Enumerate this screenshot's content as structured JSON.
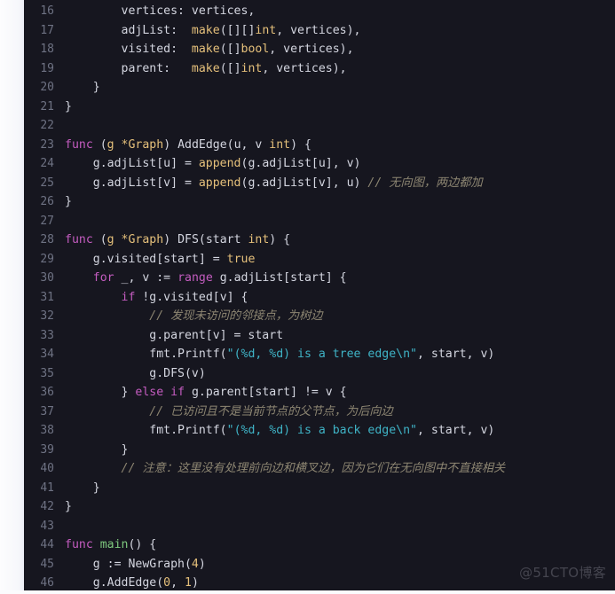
{
  "editor": {
    "language": "go",
    "theme": "dark",
    "first_line_number": 16,
    "colors": {
      "background": "#16161f",
      "gutter_text": "#6e7283",
      "default_text": "#d4d6e0",
      "keyword": "#c45cc0",
      "type_builtin": "#e5c07b",
      "function": "#7ec87e",
      "string": "#3fb3c6",
      "number": "#e5c07b",
      "comment": "#8d8672",
      "page_margin": "#fbfbfd"
    },
    "lines": [
      {
        "n": "16",
        "tokens": [
          {
            "t": "        vertices: vertices,",
            "c": "pln"
          }
        ]
      },
      {
        "n": "17",
        "tokens": [
          {
            "t": "        adjList:  ",
            "c": "pln"
          },
          {
            "t": "make",
            "c": "typ"
          },
          {
            "t": "([][]",
            "c": "pln"
          },
          {
            "t": "int",
            "c": "typ"
          },
          {
            "t": ", vertices),",
            "c": "pln"
          }
        ]
      },
      {
        "n": "18",
        "tokens": [
          {
            "t": "        visited:  ",
            "c": "pln"
          },
          {
            "t": "make",
            "c": "typ"
          },
          {
            "t": "([]",
            "c": "pln"
          },
          {
            "t": "bool",
            "c": "typ"
          },
          {
            "t": ", vertices),",
            "c": "pln"
          }
        ]
      },
      {
        "n": "19",
        "tokens": [
          {
            "t": "        parent:   ",
            "c": "pln"
          },
          {
            "t": "make",
            "c": "typ"
          },
          {
            "t": "([]",
            "c": "pln"
          },
          {
            "t": "int",
            "c": "typ"
          },
          {
            "t": ", vertices),",
            "c": "pln"
          }
        ]
      },
      {
        "n": "20",
        "tokens": [
          {
            "t": "    }",
            "c": "pln"
          }
        ]
      },
      {
        "n": "21",
        "tokens": [
          {
            "t": "}",
            "c": "pln"
          }
        ]
      },
      {
        "n": "22",
        "tokens": [
          {
            "t": "",
            "c": "pln"
          }
        ]
      },
      {
        "n": "23",
        "tokens": [
          {
            "t": "func",
            "c": "kw"
          },
          {
            "t": " (",
            "c": "pln"
          },
          {
            "t": "g *Graph",
            "c": "typ"
          },
          {
            "t": ") AddEdge(u, v ",
            "c": "pln"
          },
          {
            "t": "int",
            "c": "typ"
          },
          {
            "t": ") {",
            "c": "pln"
          }
        ]
      },
      {
        "n": "24",
        "tokens": [
          {
            "t": "    g.adjList[u] = ",
            "c": "pln"
          },
          {
            "t": "append",
            "c": "typ"
          },
          {
            "t": "(g.adjList[u], v)",
            "c": "pln"
          }
        ]
      },
      {
        "n": "25",
        "tokens": [
          {
            "t": "    g.adjList[v] = ",
            "c": "pln"
          },
          {
            "t": "append",
            "c": "typ"
          },
          {
            "t": "(g.adjList[v], u) ",
            "c": "pln"
          },
          {
            "t": "// 无向图，两边都加",
            "c": "cmt"
          }
        ]
      },
      {
        "n": "26",
        "tokens": [
          {
            "t": "}",
            "c": "pln"
          }
        ]
      },
      {
        "n": "27",
        "tokens": [
          {
            "t": "",
            "c": "pln"
          }
        ]
      },
      {
        "n": "28",
        "tokens": [
          {
            "t": "func",
            "c": "kw"
          },
          {
            "t": " (",
            "c": "pln"
          },
          {
            "t": "g *Graph",
            "c": "typ"
          },
          {
            "t": ") DFS(start ",
            "c": "pln"
          },
          {
            "t": "int",
            "c": "typ"
          },
          {
            "t": ") {",
            "c": "pln"
          }
        ]
      },
      {
        "n": "29",
        "tokens": [
          {
            "t": "    g.visited[start] = ",
            "c": "pln"
          },
          {
            "t": "true",
            "c": "typ"
          }
        ]
      },
      {
        "n": "30",
        "tokens": [
          {
            "t": "    ",
            "c": "pln"
          },
          {
            "t": "for",
            "c": "kw"
          },
          {
            "t": " _, v := ",
            "c": "pln"
          },
          {
            "t": "range",
            "c": "kw"
          },
          {
            "t": " g.adjList[start] {",
            "c": "pln"
          }
        ]
      },
      {
        "n": "31",
        "tokens": [
          {
            "t": "        ",
            "c": "pln"
          },
          {
            "t": "if",
            "c": "kw"
          },
          {
            "t": " !g.visited[v] {",
            "c": "pln"
          }
        ]
      },
      {
        "n": "32",
        "tokens": [
          {
            "t": "            ",
            "c": "pln"
          },
          {
            "t": "// 发现未访问的邻接点，为树边",
            "c": "cmt"
          }
        ]
      },
      {
        "n": "33",
        "tokens": [
          {
            "t": "            g.parent[v] = start",
            "c": "pln"
          }
        ]
      },
      {
        "n": "34",
        "tokens": [
          {
            "t": "            fmt.Printf(",
            "c": "pln"
          },
          {
            "t": "\"(%d, %d) is a tree edge\\n\"",
            "c": "str"
          },
          {
            "t": ", start, v)",
            "c": "pln"
          }
        ]
      },
      {
        "n": "35",
        "tokens": [
          {
            "t": "            g.DFS(v)",
            "c": "pln"
          }
        ]
      },
      {
        "n": "36",
        "tokens": [
          {
            "t": "        } ",
            "c": "pln"
          },
          {
            "t": "else",
            "c": "kw"
          },
          {
            "t": " ",
            "c": "pln"
          },
          {
            "t": "if",
            "c": "kw"
          },
          {
            "t": " g.parent[start] != v {",
            "c": "pln"
          }
        ]
      },
      {
        "n": "37",
        "tokens": [
          {
            "t": "            ",
            "c": "pln"
          },
          {
            "t": "// 已访问且不是当前节点的父节点，为后向边",
            "c": "cmt"
          }
        ]
      },
      {
        "n": "38",
        "tokens": [
          {
            "t": "            fmt.Printf(",
            "c": "pln"
          },
          {
            "t": "\"(%d, %d) is a back edge\\n\"",
            "c": "str"
          },
          {
            "t": ", start, v)",
            "c": "pln"
          }
        ]
      },
      {
        "n": "39",
        "tokens": [
          {
            "t": "        }",
            "c": "pln"
          }
        ]
      },
      {
        "n": "40",
        "tokens": [
          {
            "t": "        ",
            "c": "pln"
          },
          {
            "t": "// 注意：这里没有处理前向边和横叉边，因为它们在无向图中不直接相关",
            "c": "cmt"
          }
        ]
      },
      {
        "n": "41",
        "tokens": [
          {
            "t": "    }",
            "c": "pln"
          }
        ]
      },
      {
        "n": "42",
        "tokens": [
          {
            "t": "}",
            "c": "pln"
          }
        ]
      },
      {
        "n": "43",
        "tokens": [
          {
            "t": "",
            "c": "pln"
          }
        ]
      },
      {
        "n": "44",
        "tokens": [
          {
            "t": "func",
            "c": "kw"
          },
          {
            "t": " ",
            "c": "pln"
          },
          {
            "t": "main",
            "c": "fn"
          },
          {
            "t": "() {",
            "c": "pln"
          }
        ]
      },
      {
        "n": "45",
        "tokens": [
          {
            "t": "    g := NewGraph(",
            "c": "pln"
          },
          {
            "t": "4",
            "c": "num"
          },
          {
            "t": ")",
            "c": "pln"
          }
        ]
      },
      {
        "n": "46",
        "tokens": [
          {
            "t": "    g.AddEdge(",
            "c": "pln"
          },
          {
            "t": "0",
            "c": "num"
          },
          {
            "t": ", ",
            "c": "pln"
          },
          {
            "t": "1",
            "c": "num"
          },
          {
            "t": ")",
            "c": "pln"
          }
        ]
      }
    ]
  },
  "watermark": {
    "text": "@51CTO博客"
  }
}
